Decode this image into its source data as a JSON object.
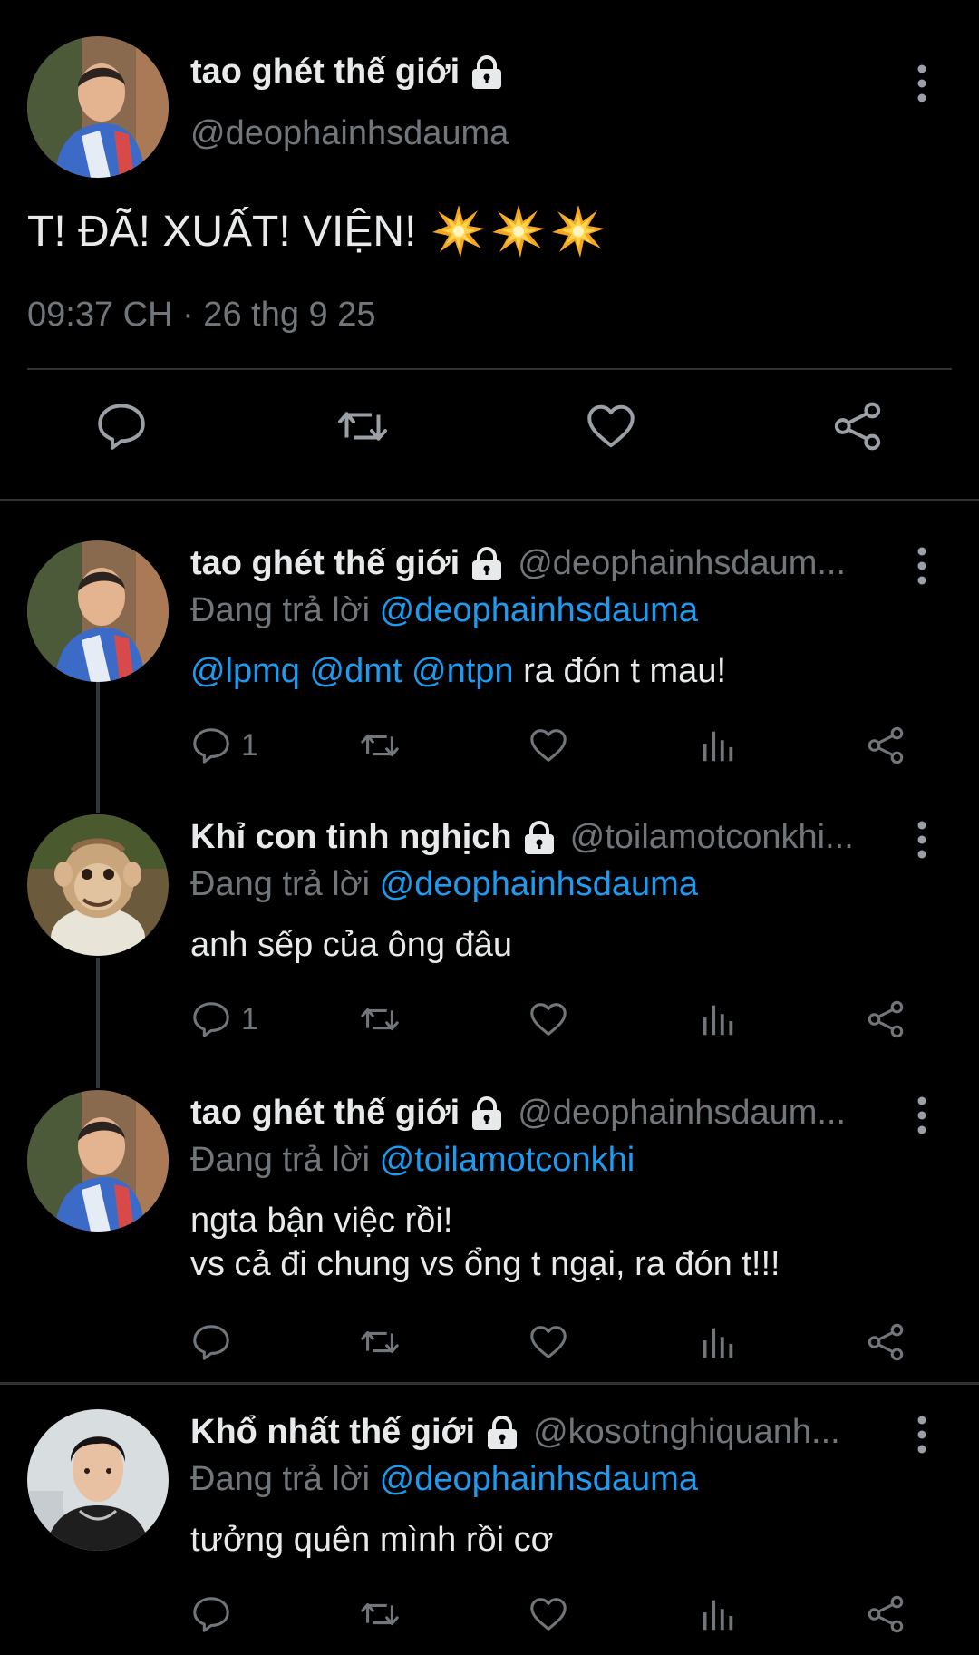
{
  "main_tweet": {
    "display_name": "tao ghét thế giới",
    "handle": "@deophainhsdauma",
    "text": "T! ĐÃ! XUẤT! VIỆN!",
    "emoji_icons": [
      "collision-emoji",
      "collision-emoji",
      "collision-emoji"
    ],
    "timestamp": "09:37 CH · 26 thg 9 25"
  },
  "replies": [
    {
      "display_name": "tao ghét thế giới",
      "handle": "@deophainhsdaum...",
      "replying_prefix": "Đang trả lời",
      "replying_to": "@deophainhsdauma",
      "mentions": [
        "@lpmq",
        "@dmt",
        "@ntpn"
      ],
      "text": "ra đón t mau!",
      "reply_count": "1"
    },
    {
      "display_name": "Khỉ con tinh nghịch",
      "handle": "@toilamotconkhi...",
      "replying_prefix": "Đang trả lời",
      "replying_to": "@deophainhsdauma",
      "text": "anh sếp của ông đâu",
      "reply_count": "1"
    },
    {
      "display_name": "tao ghét thế giới",
      "handle": "@deophainhsdaum...",
      "replying_prefix": "Đang trả lời",
      "replying_to": "@toilamotconkhi",
      "text_line1": "ngta bận việc rồi!",
      "text_line2": "vs cả đi chung vs ổng t ngại, ra đón t!!!",
      "reply_count": ""
    },
    {
      "display_name": "Khổ nhất thế giới",
      "handle": "@kosotnghiquanh...",
      "replying_prefix": "Đang trả lời",
      "replying_to": "@deophainhsdauma",
      "text": "tưởng quên mình rồi cơ",
      "reply_count": ""
    }
  ],
  "colors": {
    "background": "#000000",
    "text_primary": "#e7e9ea",
    "text_secondary": "#71767b",
    "link": "#1d9bf0",
    "divider": "#2f3336"
  }
}
